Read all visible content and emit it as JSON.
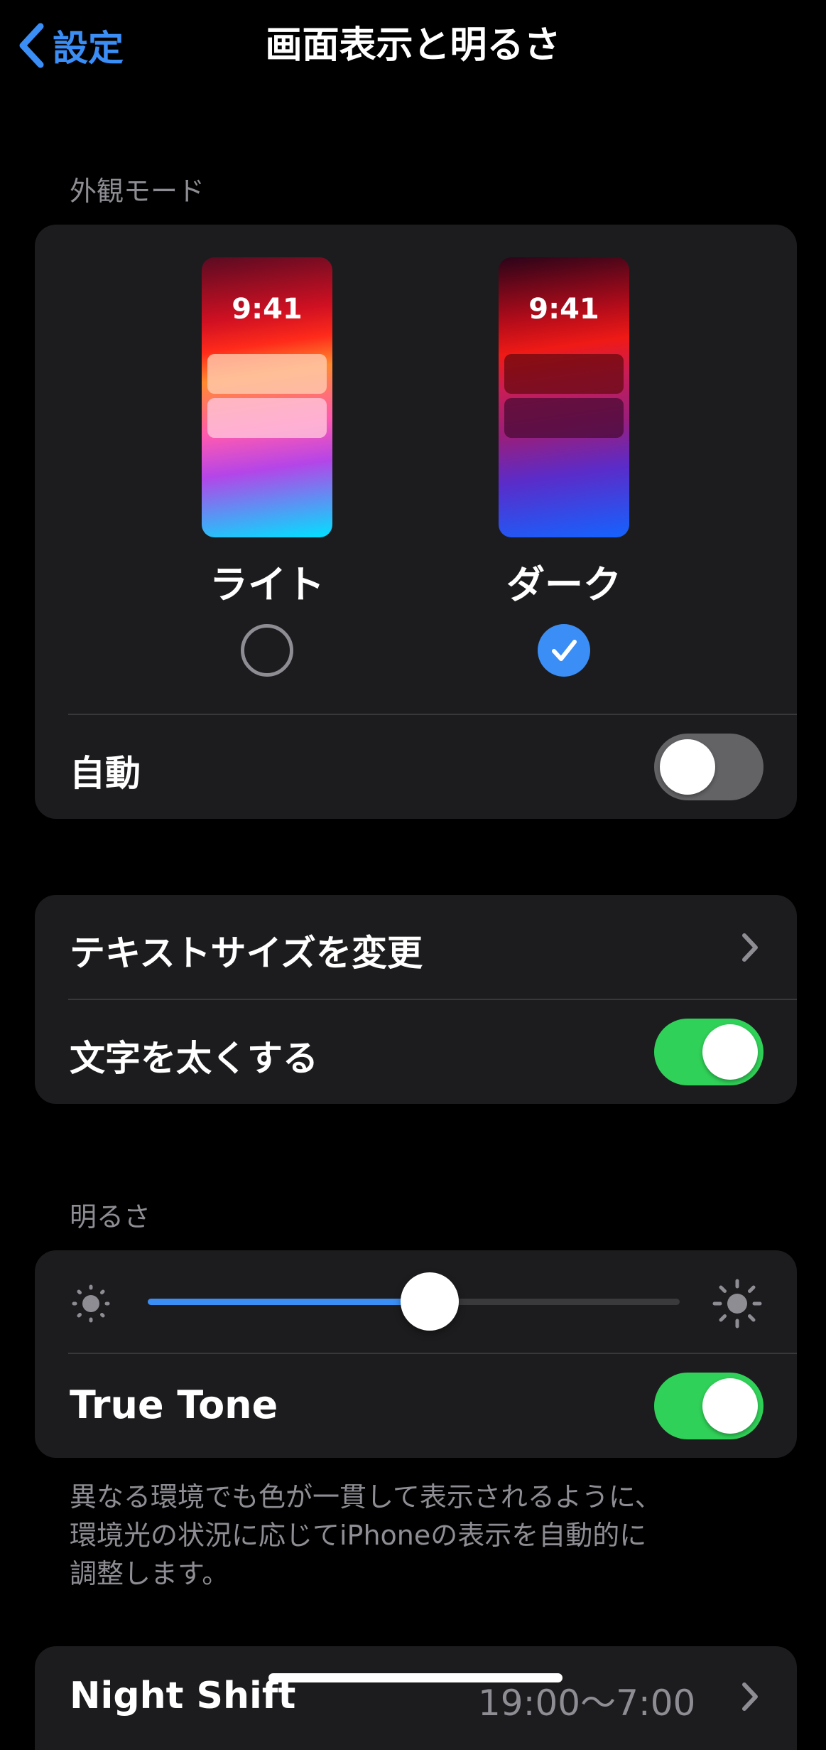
{
  "nav": {
    "back_label": "設定",
    "title": "画面表示と明るさ"
  },
  "appearance": {
    "header": "外観モード",
    "options": [
      {
        "label": "ライト",
        "time": "9:41",
        "selected": false
      },
      {
        "label": "ダーク",
        "time": "9:41",
        "selected": true
      }
    ],
    "auto_label": "自動",
    "auto_on": false
  },
  "text": {
    "text_size_label": "テキストサイズを変更",
    "bold_text_label": "文字を太くする",
    "bold_text_on": true
  },
  "brightness": {
    "header": "明るさ",
    "level": 0.53,
    "true_tone_label": "True Tone",
    "true_tone_on": true,
    "footer_lines": [
      "異なる環境でも色が一貫して表示されるように、",
      "環境光の状況に応じてiPhoneの表示を自動的に",
      "調整します。"
    ]
  },
  "night_shift": {
    "label": "Night Shift",
    "value": "19:00～7:00"
  },
  "colors": {
    "accent": "#3a8ef6",
    "toggle_on": "#30d158",
    "toggle_off": "#636366",
    "cell_bg": "#1c1c1e",
    "secondary_text": "#8d8d93"
  },
  "icons": {
    "back": "chevron-left-icon",
    "disclosure": "chevron-right-icon",
    "brightness_low": "sun-small-icon",
    "brightness_high": "sun-large-icon",
    "check": "checkmark-icon"
  }
}
